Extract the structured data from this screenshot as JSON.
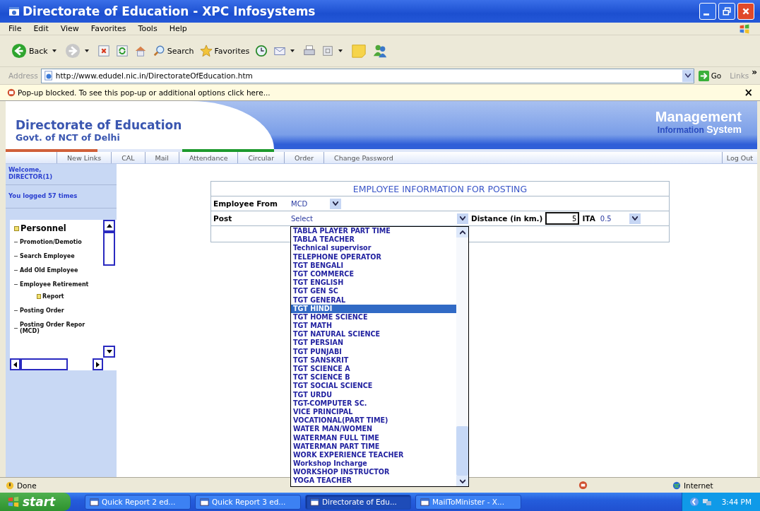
{
  "window": {
    "title": "Directorate of Education - XPC Infosystems"
  },
  "menu": [
    "File",
    "Edit",
    "View",
    "Favorites",
    "Tools",
    "Help"
  ],
  "toolbar": [
    {
      "kind": "back",
      "label": "Back",
      "caret": true
    },
    {
      "kind": "forward",
      "caret": true
    },
    {
      "kind": "stop"
    },
    {
      "kind": "refresh"
    },
    {
      "kind": "home"
    },
    {
      "kind": "search",
      "label": "Search"
    },
    {
      "kind": "favorites",
      "label": "Favorites"
    },
    {
      "kind": "history"
    },
    {
      "kind": "mail",
      "caret": true
    },
    {
      "kind": "print"
    },
    {
      "kind": "edit",
      "caret": true
    },
    {
      "kind": "notes"
    },
    {
      "kind": "messenger"
    }
  ],
  "address": {
    "label": "Address",
    "value": "http://www.edudel.nic.in/DirectorateOfEducation.htm",
    "go": "Go",
    "links": "Links",
    "more": "»"
  },
  "popup_bar": {
    "text": "Pop-up blocked. To see this pop-up or additional options click here...",
    "close": "×"
  },
  "header": {
    "title": "Directorate of Education",
    "subtitle": "Govt. of NCT of Delhi",
    "brand_main": "Management",
    "brand_info": "Information",
    "brand_system": "System"
  },
  "nav": [
    "New Links",
    "CAL",
    "Mail",
    "Attendance",
    "Circular",
    "Order",
    "Change Password"
  ],
  "logout": "Log Out",
  "sidebar": {
    "welcome": "Welcome,",
    "user": "DIRECTOR(1)",
    "logins": "You logged 57 times",
    "menu_title": "Personnel",
    "items": [
      {
        "label": "Promotion/Demotio"
      },
      {
        "label": "Search Employee"
      },
      {
        "label": "Add Old Employee"
      },
      {
        "label": "Employee Retirement",
        "children": [
          {
            "label": "Report"
          }
        ]
      },
      {
        "label": "Posting Order"
      },
      {
        "label": "Posting Order Repor (MCD)"
      }
    ]
  },
  "form": {
    "title": "EMPLOYEE INFORMATION FOR POSTING",
    "employee_from": {
      "label": "Employee From",
      "value": "MCD"
    },
    "post": {
      "label": "Post",
      "value": "Select",
      "options": [
        {
          "label": "TABLA PLAYER PART TIME",
          "selected": false
        },
        {
          "label": "TABLA TEACHER",
          "selected": false
        },
        {
          "label": "Technical supervisor",
          "selected": false
        },
        {
          "label": "TELEPHONE OPERATOR",
          "selected": false
        },
        {
          "label": "TGT BENGALI",
          "selected": false
        },
        {
          "label": "TGT COMMERCE",
          "selected": false
        },
        {
          "label": "TGT ENGLISH",
          "selected": false
        },
        {
          "label": "TGT GEN SC",
          "selected": false
        },
        {
          "label": "TGT GENERAL",
          "selected": false
        },
        {
          "label": "TGT HINDI",
          "selected": true
        },
        {
          "label": "TGT HOME SCIENCE",
          "selected": false
        },
        {
          "label": "TGT MATH",
          "selected": false
        },
        {
          "label": "TGT NATURAL SCIENCE",
          "selected": false
        },
        {
          "label": "TGT PERSIAN",
          "selected": false
        },
        {
          "label": "TGT PUNJABI",
          "selected": false
        },
        {
          "label": "TGT SANSKRIT",
          "selected": false
        },
        {
          "label": "TGT SCIENCE A",
          "selected": false
        },
        {
          "label": "TGT SCIENCE B",
          "selected": false
        },
        {
          "label": "TGT SOCIAL SCIENCE",
          "selected": false
        },
        {
          "label": "TGT URDU",
          "selected": false
        },
        {
          "label": "TGT-COMPUTER SC.",
          "selected": false
        },
        {
          "label": "VICE PRINCIPAL",
          "selected": false
        },
        {
          "label": "VOCATIONAL(PART TIME)",
          "selected": false
        },
        {
          "label": "WATER MAN/WOMEN",
          "selected": false
        },
        {
          "label": "WATERMAN FULL TIME",
          "selected": false
        },
        {
          "label": "WATERMAN PART TIME",
          "selected": false
        },
        {
          "label": "WORK EXPERIENCE TEACHER",
          "selected": false
        },
        {
          "label": "Workshop Incharge",
          "selected": false
        },
        {
          "label": "WORKSHOP INSTRUCTOR",
          "selected": false
        },
        {
          "label": "YOGA TEACHER",
          "selected": false
        }
      ]
    },
    "distance": {
      "label": "Distance (in km.)",
      "value": "5"
    },
    "ita": {
      "label": "ITA",
      "value": "0.5"
    }
  },
  "status_bar": {
    "text": "Done",
    "zone": "Internet"
  },
  "taskbar": {
    "start": "start",
    "tasks": [
      {
        "label": "Quick Report 2 ed...",
        "selected": false
      },
      {
        "label": "Quick Report 3 ed...",
        "selected": false
      },
      {
        "label": "Directorate of Edu...",
        "selected": true
      },
      {
        "label": "MailToMinister - X...",
        "selected": false
      }
    ],
    "clock": "3:44 PM"
  }
}
